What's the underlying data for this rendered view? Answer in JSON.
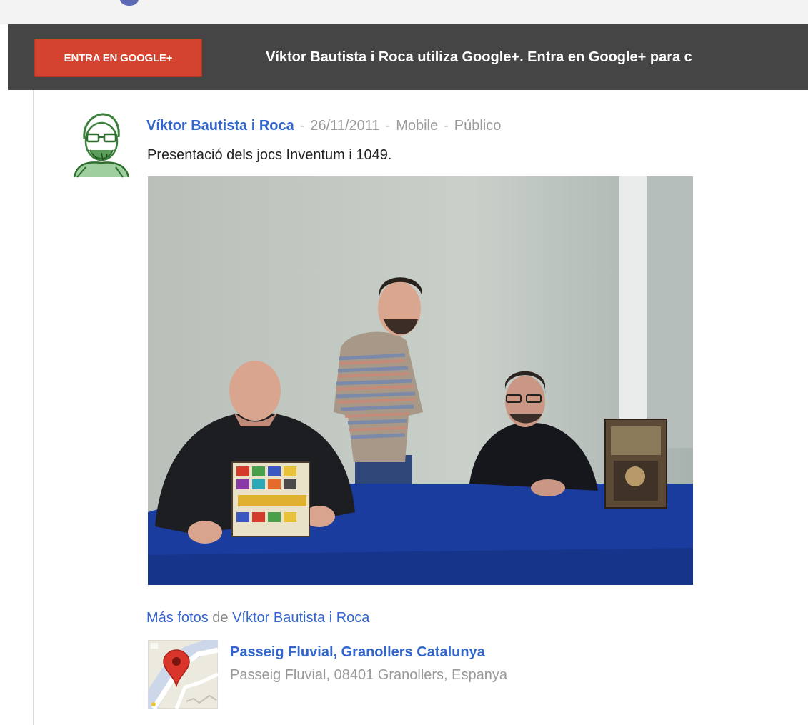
{
  "banner": {
    "button_label": "ENTRA EN GOOGLE+",
    "message": "Víktor Bautista i Roca utiliza Google+. Entra en Google+ para c"
  },
  "post": {
    "author": "Víktor Bautista i Roca",
    "date": "26/11/2011",
    "source": "Mobile",
    "visibility": "Público",
    "separator": "-",
    "text": "Presentació dels jocs Inventum i 1049."
  },
  "more_photos": {
    "link_label": "Más fotos",
    "connector": "de",
    "author": "Víktor Bautista i Roca"
  },
  "place": {
    "name": "Passeig Fluvial, Granollers Catalunya",
    "address": "Passeig Fluvial, 08401 Granollers, Espanya"
  },
  "icons": {
    "avatar": "sketch-portrait-avatar",
    "map": "map-pin-icon"
  },
  "colors": {
    "banner_bg": "#454545",
    "button_bg": "#d4432f",
    "link": "#3366cc"
  }
}
